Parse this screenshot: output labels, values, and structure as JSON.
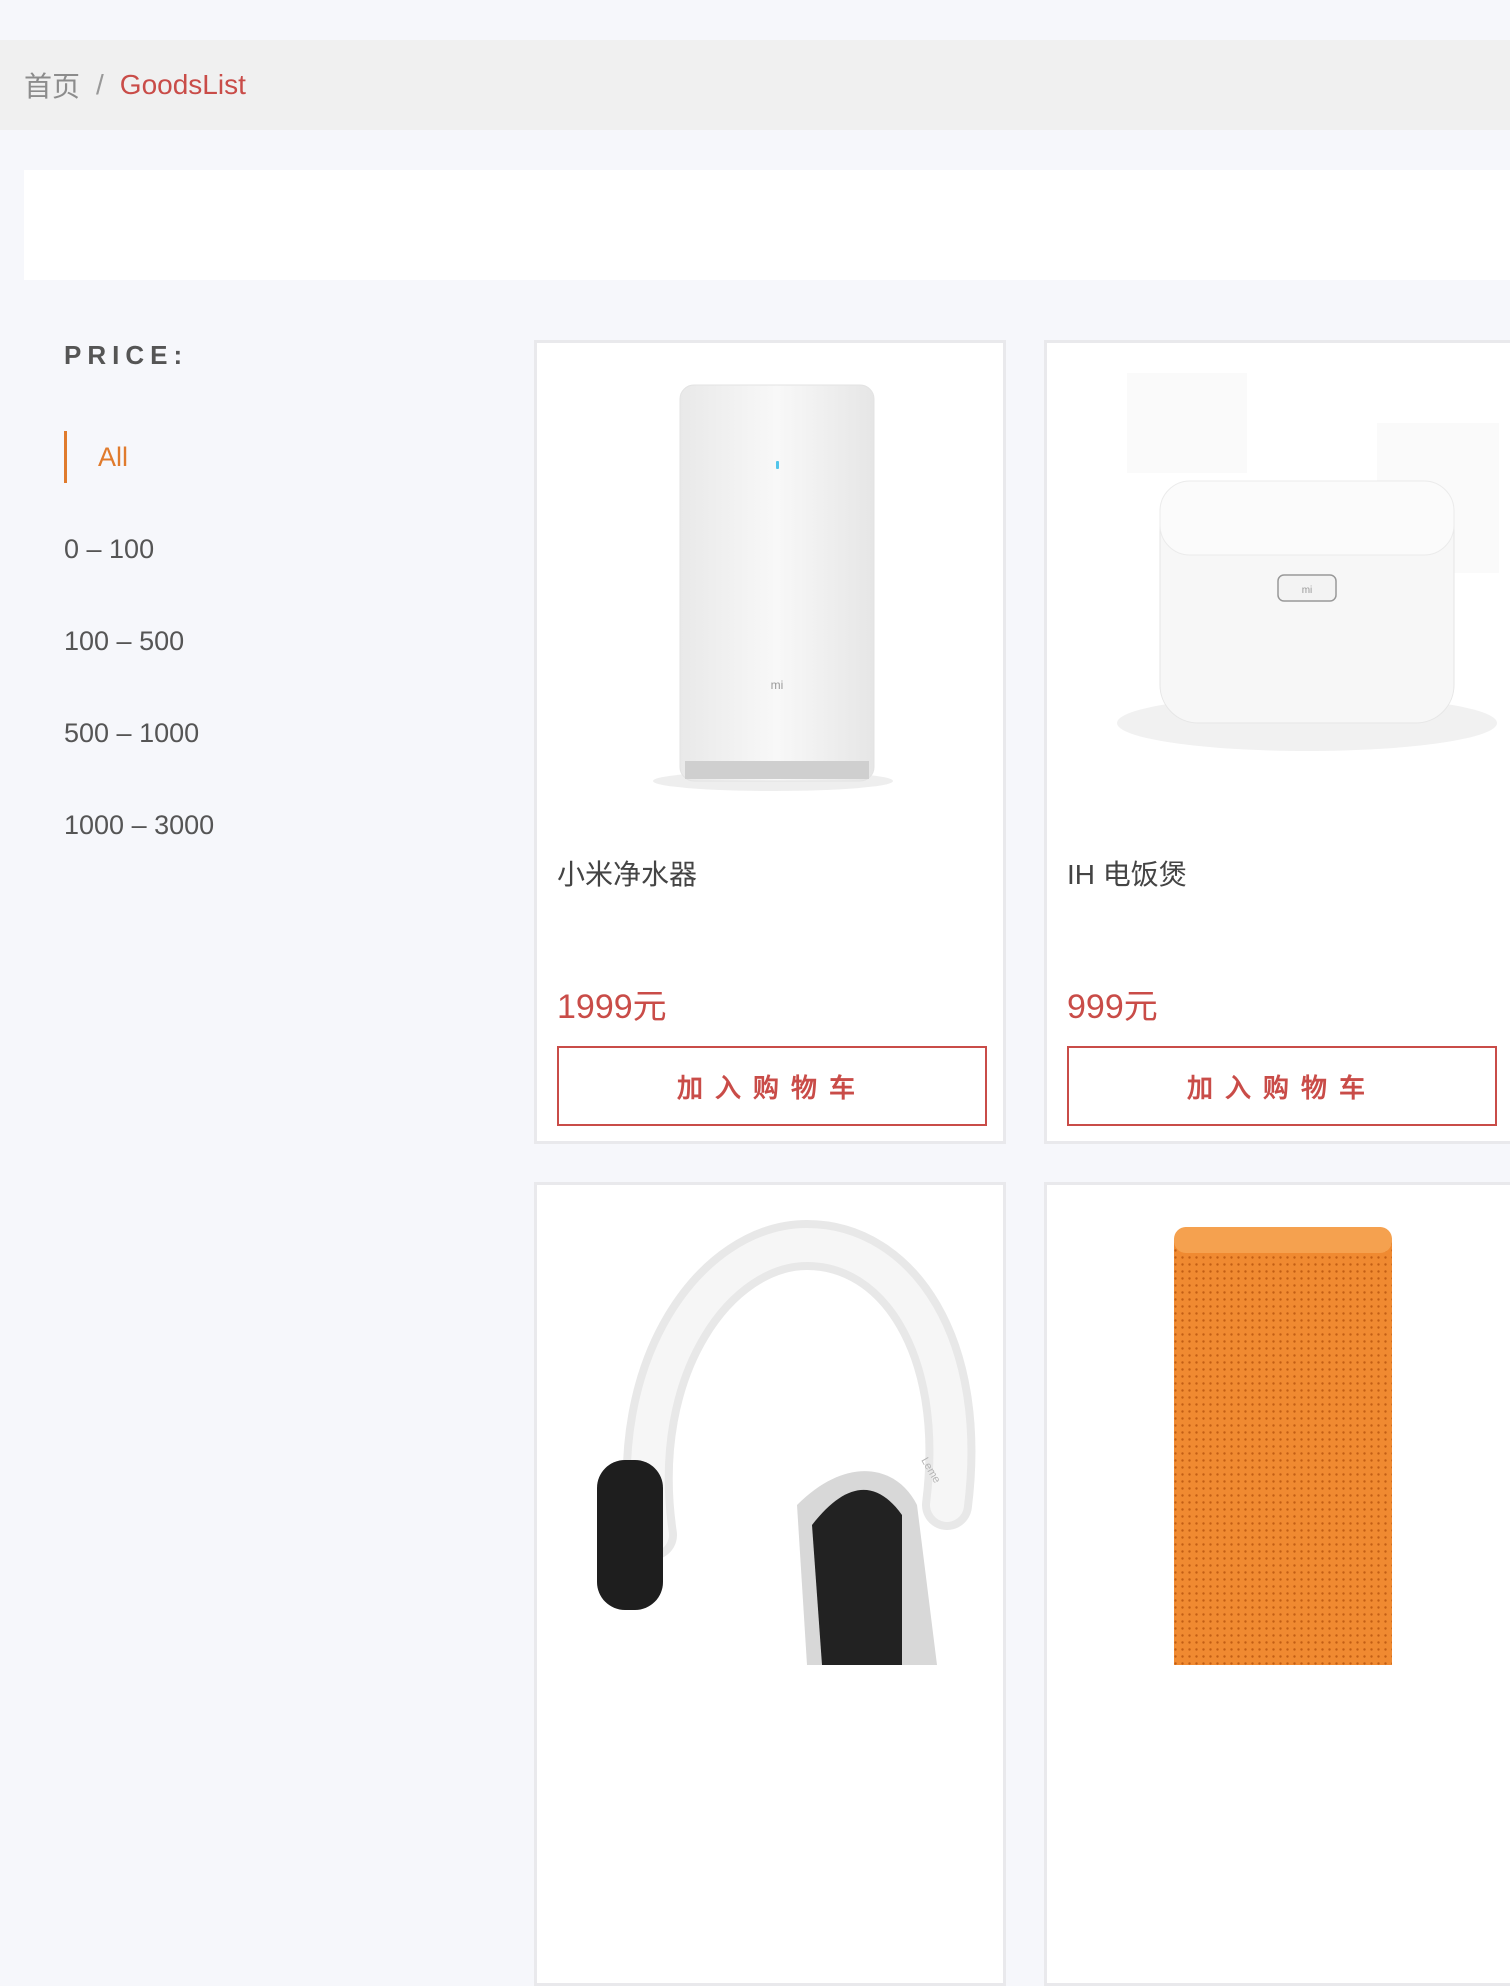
{
  "breadcrumb": {
    "home": "首页",
    "separator": "/",
    "current": "GoodsList"
  },
  "filter": {
    "title": "PRICE:",
    "options": [
      "All",
      "0 – 100",
      "100 – 500",
      "500 – 1000",
      "1000 – 3000"
    ],
    "selected": "All"
  },
  "products": [
    {
      "name": "小米净水器",
      "price": "1999元",
      "button_label": "加入购物车",
      "image_icon": "water-purifier-image"
    },
    {
      "name": "IH 电饭煲",
      "price": "999元",
      "button_label": "加入购物车",
      "image_icon": "rice-cooker-image"
    },
    {
      "name": "",
      "price": "",
      "button_label": "",
      "image_icon": "headphones-image"
    },
    {
      "name": "",
      "price": "",
      "button_label": "",
      "image_icon": "speaker-image"
    }
  ],
  "colors": {
    "accent_red": "#c94c48",
    "active_orange": "#e07b2d",
    "background": "#f6f7fb"
  }
}
